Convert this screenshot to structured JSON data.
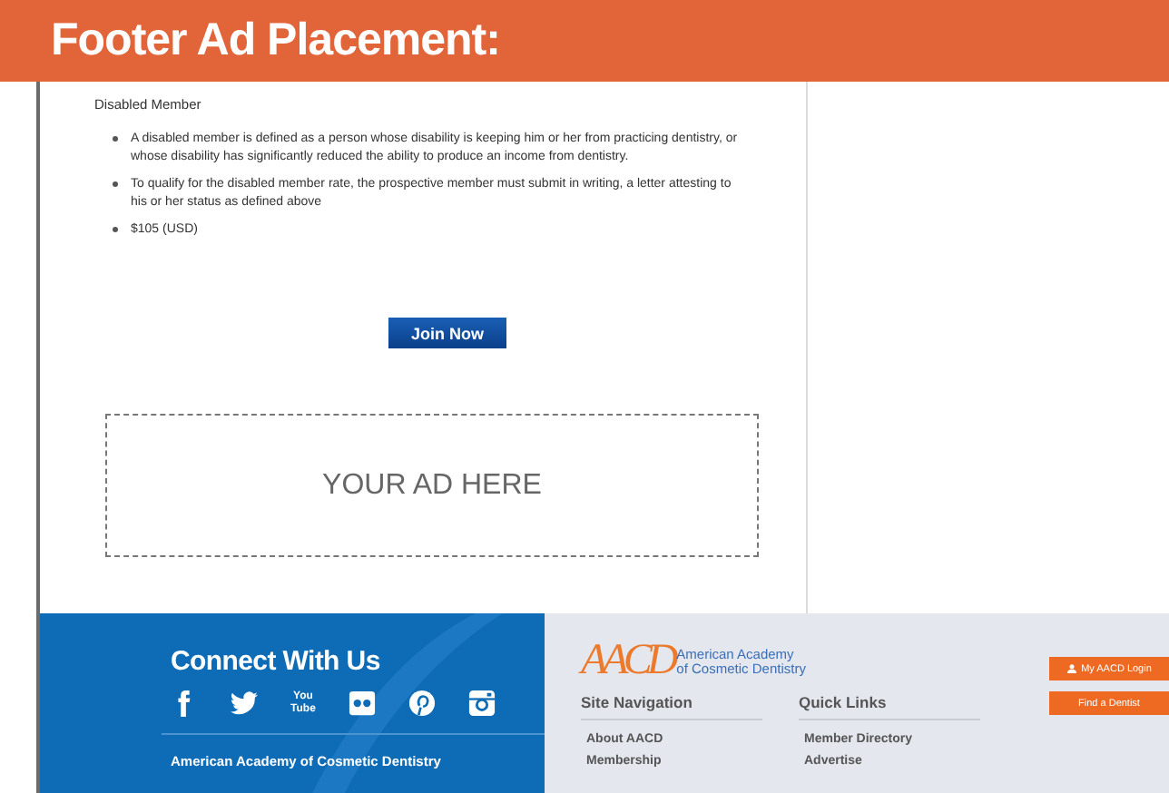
{
  "banner": {
    "title": "Footer Ad Placement:"
  },
  "membership": {
    "heading": "Disabled Member",
    "bullets": [
      "A disabled member is defined as a person whose disability is keeping him or her from practicing dentistry, or whose disability has significantly reduced the ability to produce an income from dentistry.",
      "To qualify for the disabled member rate, the prospective member must submit in writing, a letter attesting to his or her status as defined above",
      "$105 (USD)"
    ],
    "button": "Join Now"
  },
  "ad": {
    "text": "YOUR AD HERE"
  },
  "footer": {
    "connect_title": "Connect With Us",
    "social": [
      {
        "kind": "facebook"
      },
      {
        "kind": "twitter"
      },
      {
        "kind": "youtube",
        "text": "You Tube"
      },
      {
        "kind": "flickr"
      },
      {
        "kind": "pinterest"
      },
      {
        "kind": "instagram"
      }
    ],
    "org_name": "American Academy of Cosmetic Dentistry",
    "logo": {
      "mark": "AACD",
      "name_line1": "American Academy",
      "name_line2": "of Cosmetic Dentistry"
    },
    "columns": [
      {
        "title": "Site Navigation",
        "links": [
          "About AACD",
          "Membership"
        ]
      },
      {
        "title": "Quick Links",
        "links": [
          "Member Directory",
          "Advertise"
        ]
      }
    ],
    "buttons": [
      {
        "label": "My AACD Login",
        "icon": true
      },
      {
        "label": "Find a Dentist",
        "icon": false
      }
    ]
  }
}
